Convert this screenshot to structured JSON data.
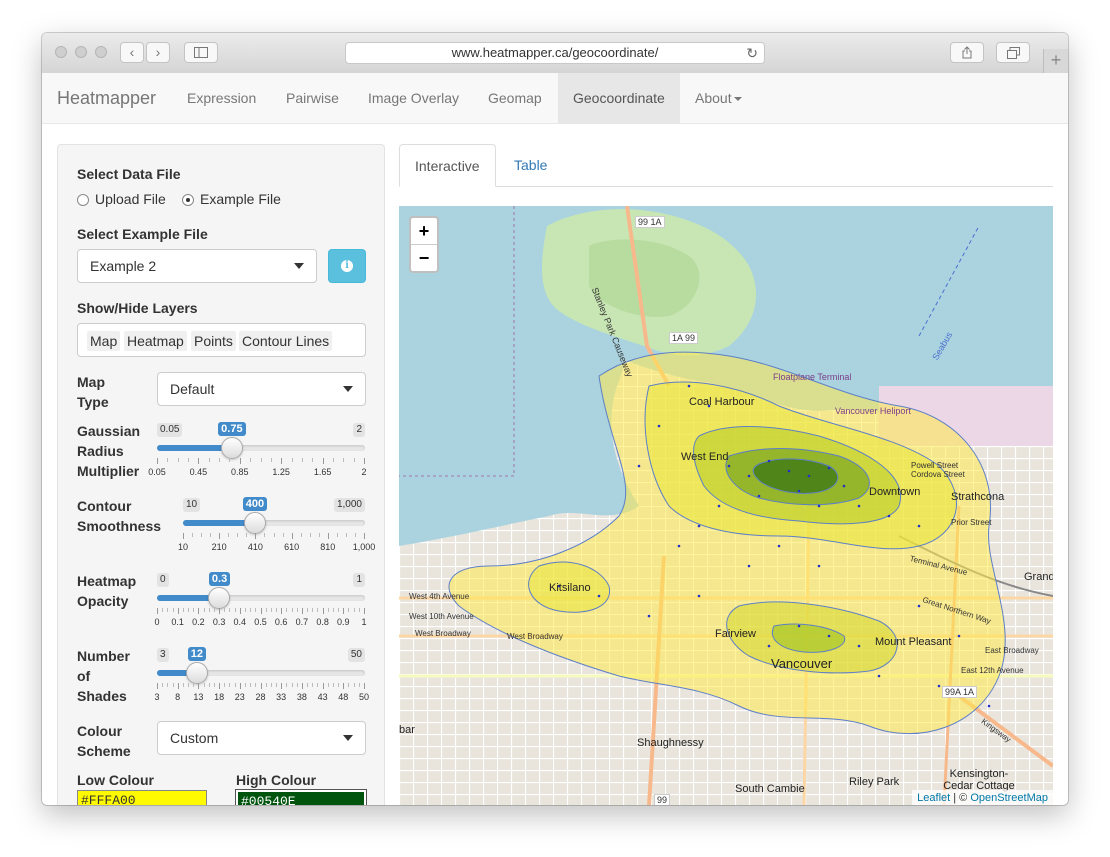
{
  "browser": {
    "url": "www.heatmapper.ca/geocoordinate/"
  },
  "navbar": {
    "brand": "Heatmapper",
    "items": [
      "Expression",
      "Pairwise",
      "Image Overlay",
      "Geomap",
      "Geocoordinate",
      "About"
    ],
    "active": "Geocoordinate"
  },
  "sidebar": {
    "select_data_file": {
      "label": "Select Data File",
      "options": [
        "Upload File",
        "Example File"
      ],
      "selected": "Example File"
    },
    "example_file": {
      "label": "Select Example File",
      "value": "Example 2"
    },
    "layers": {
      "label": "Show/Hide Layers",
      "chips": [
        "Map",
        "Heatmap",
        "Points",
        "Contour Lines"
      ]
    },
    "map_type": {
      "label_line1": "Map",
      "label_line2": "Type",
      "value": "Default"
    },
    "gaussian": {
      "label_lines": [
        "Gaussian",
        "Radius",
        "Multiplier"
      ],
      "min": "0.05",
      "max": "2",
      "value": "0.75",
      "fraction": 0.359,
      "ticks": [
        "0.05",
        "0.45",
        "0.85",
        "1.25",
        "1.65",
        "2"
      ]
    },
    "contour": {
      "label_lines": [
        "Contour",
        "Smoothness"
      ],
      "min": "10",
      "max": "1,000",
      "value": "400",
      "fraction": 0.394,
      "ticks": [
        "10",
        "210",
        "410",
        "610",
        "810",
        "1,000"
      ]
    },
    "opacity": {
      "label_lines": [
        "Heatmap",
        "Opacity"
      ],
      "min": "0",
      "max": "1",
      "value": "0.3",
      "fraction": 0.3,
      "ticks": [
        "0",
        "0.1",
        "0.2",
        "0.3",
        "0.4",
        "0.5",
        "0.6",
        "0.7",
        "0.8",
        "0.9",
        "1"
      ]
    },
    "shades": {
      "label_lines": [
        "Number",
        "of",
        "Shades"
      ],
      "min": "3",
      "max": "50",
      "value": "12",
      "fraction": 0.191,
      "ticks": [
        "3",
        "8",
        "13",
        "18",
        "23",
        "28",
        "33",
        "38",
        "43",
        "48",
        "50"
      ]
    },
    "colour_scheme": {
      "label_line1": "Colour",
      "label_line2": "Scheme",
      "value": "Custom"
    },
    "low_colour": {
      "label": "Low Colour",
      "value": "#FFFA00",
      "color": "#FFFA00"
    },
    "high_colour": {
      "label": "High Colour",
      "value": "#00540E",
      "color": "#00540E"
    }
  },
  "tabs": [
    "Interactive",
    "Table"
  ],
  "map": {
    "zoom_in": "+",
    "zoom_out": "−",
    "labels": {
      "coal_harbour": "Coal Harbour",
      "west_end": "West End",
      "kitsilano": "Kitsilano",
      "fairview": "Fairview",
      "vancouver": "Vancouver",
      "strathcona": "Strathcona",
      "downtown": "Downtown",
      "mount_pleasant": "Mount Pleasant",
      "shaughnessy": "Shaughnessy",
      "south_cambie": "South Cambie",
      "riley_park": "Riley Park",
      "kensington": "Kensington-Cedar Cottage",
      "stanley_park_causeway": "Stanley Park Causeway",
      "floatplane": "Floatplane Terminal",
      "vancouver_heliport": "Vancouver Heliport",
      "west_4th": "West 4th Avenue",
      "west_10th": "West 10th Avenue",
      "west_broadway": "West Broadway",
      "terminal_ave": "Terminal Avenue",
      "great_northern": "Great Northern Way",
      "e_12th": "East 12th Avenue",
      "east_broadway": "East Broadway",
      "prior": "Prior Street",
      "powell": "Powell Street",
      "cordova": "Cordova Street",
      "kingsway": "Kingsway",
      "seabus": "Seabus",
      "bar": "bar",
      "route_99_1a": "99 1A",
      "route_1a_99": "1A 99",
      "route_99a_1a": "99A 1A",
      "route_99": "99",
      "grand": "Grand"
    },
    "attribution_leaflet": "Leaflet",
    "attribution_sep": " | © ",
    "attribution_osm": "OpenStreetMap"
  }
}
